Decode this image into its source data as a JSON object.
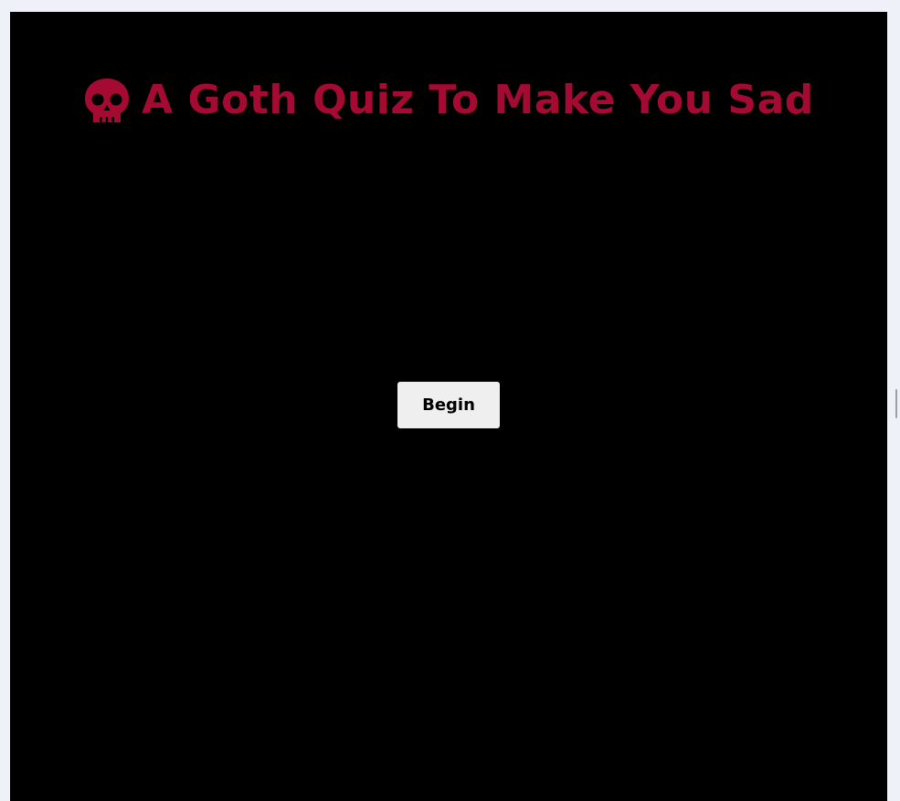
{
  "header": {
    "title": "A Goth Quiz To Make You Sad",
    "icon": "skull-icon"
  },
  "actions": {
    "begin_label": "Begin"
  },
  "colors": {
    "page_background": "#eef2f8",
    "stage_background": "#000000",
    "accent": "#a50a32",
    "button_background": "#efefef",
    "button_text": "#000000"
  }
}
